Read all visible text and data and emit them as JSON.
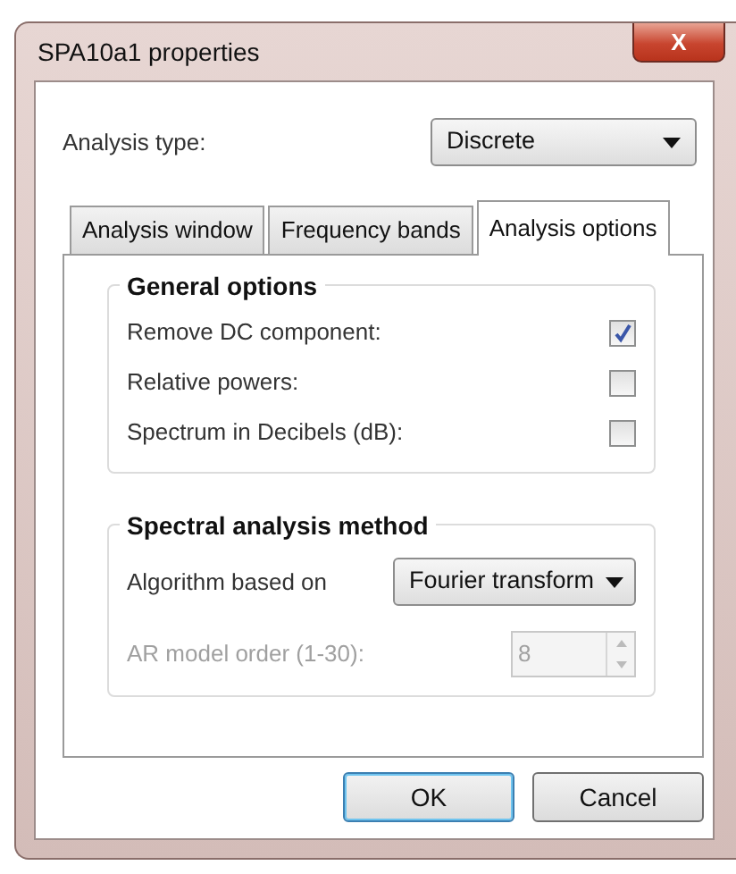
{
  "window": {
    "title": "SPA10a1 properties",
    "close_label": "X"
  },
  "analysis_type": {
    "label": "Analysis type:",
    "value": "Discrete"
  },
  "tabs": [
    {
      "label": "Analysis window",
      "selected": false
    },
    {
      "label": "Frequency bands",
      "selected": false
    },
    {
      "label": "Analysis options",
      "selected": true
    }
  ],
  "general_options": {
    "title": "General options",
    "options": [
      {
        "label": "Remove DC component:",
        "checked": true
      },
      {
        "label": "Relative powers:",
        "checked": false
      },
      {
        "label": "Spectrum in Decibels (dB):",
        "checked": false
      }
    ]
  },
  "spectral_method": {
    "title": "Spectral analysis method",
    "algorithm": {
      "label": "Algorithm based on",
      "value": "Fourier transform"
    },
    "ar_order": {
      "label": "AR model order (1-30):",
      "value": "8",
      "disabled": true
    }
  },
  "buttons": [
    {
      "label": "OK",
      "default": true
    },
    {
      "label": "Cancel",
      "default": false
    }
  ]
}
